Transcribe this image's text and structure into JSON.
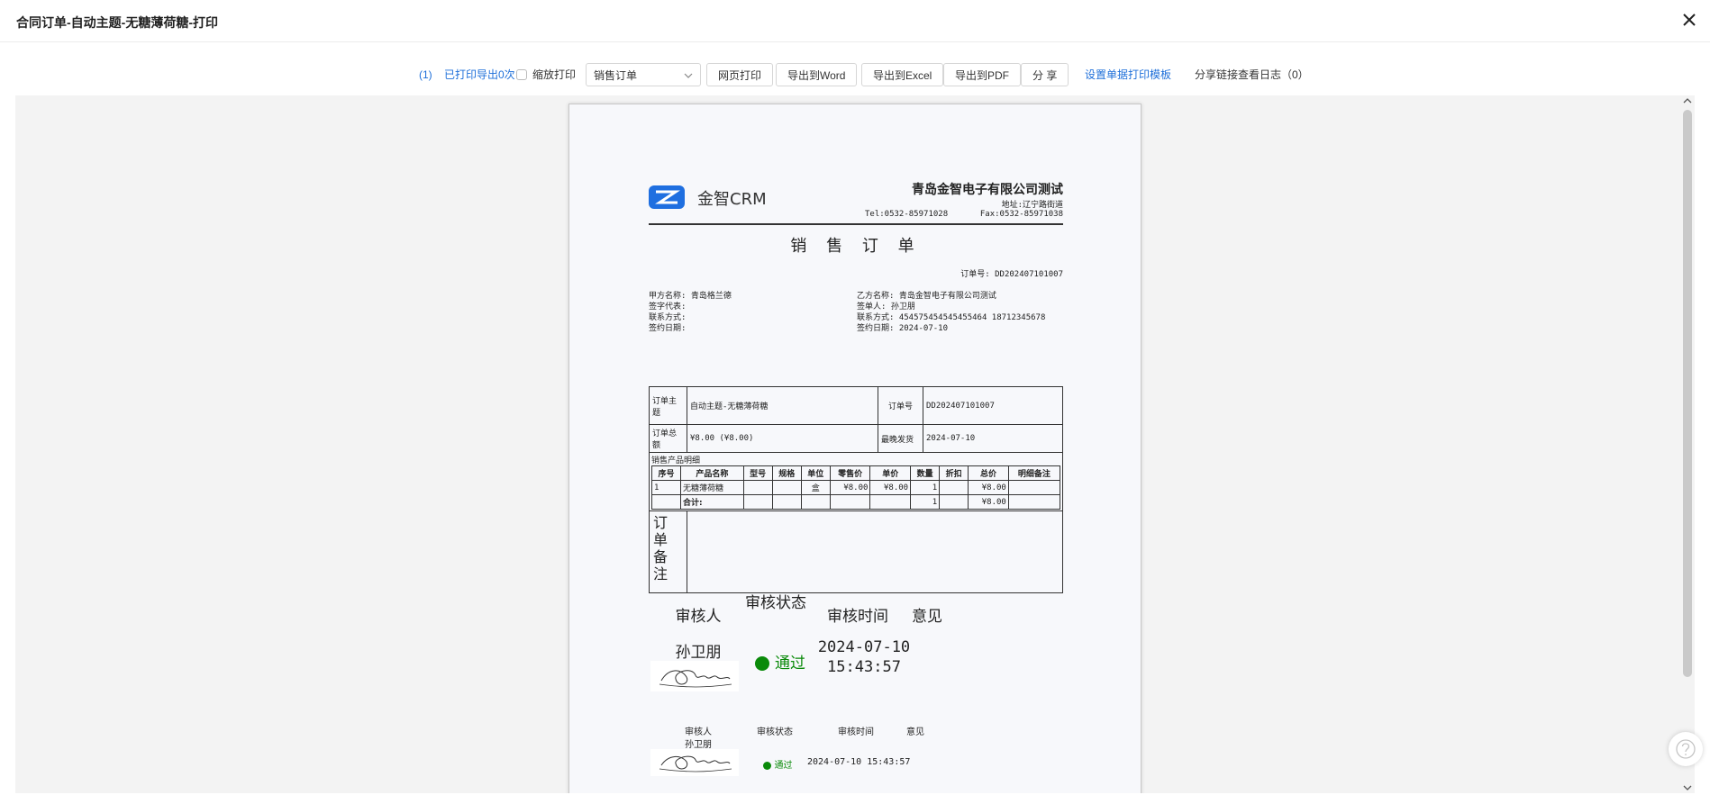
{
  "header": {
    "title": "合同订单-自动主题-无糖薄荷糖-打印"
  },
  "toolbar": {
    "print_count_link": "(1)",
    "printed_label": "已打印导出0次",
    "zoom_print_label": "缩放打印",
    "template_select": "销售订单",
    "web_print": "网页打印",
    "export_word": "导出到Word",
    "export_excel": "导出到Excel",
    "export_pdf": "导出到PDF",
    "share": "分 享",
    "set_template": "设置单据打印模板",
    "share_log": "分享链接查看日志（0）"
  },
  "document": {
    "logo_text": "金智CRM",
    "company": "青岛金智电子有限公司测试",
    "address": "地址:辽宁路街道",
    "tel": "Tel:0532-85971028",
    "fax": "Fax:0532-85971038",
    "title": "销 售 订 单",
    "order_no_line": "订单号: DD202407101007",
    "party_a": [
      "甲方名称: 青岛格兰德",
      "签字代表:",
      "联系方式:",
      "签约日期:"
    ],
    "party_b": [
      "乙方名称: 青岛金智电子有限公司测试",
      "签单人: 孙卫朋",
      "联系方式: 454575454545455464 18712345678",
      "签约日期: 2024-07-10"
    ],
    "info": {
      "subject_label": "订单主题",
      "subject_value": "自动主题-无糖薄荷糖",
      "order_no_label": "订单号",
      "order_no_value": "DD202407101007",
      "total_label": "订单总额",
      "total_value": "¥8.00 (¥8.00)",
      "ship_label": "最晚发货",
      "ship_value": "2024-07-10",
      "detail_label": "销售产品明细"
    },
    "products": {
      "headers": [
        "序号",
        "产品名称",
        "型号",
        "规格",
        "单位",
        "零售价",
        "单价",
        "数量",
        "折扣",
        "总价",
        "明细备注"
      ],
      "rows": [
        [
          "1",
          "无糖薄荷糖",
          "",
          "",
          "盒",
          "¥8.00",
          "¥8.00",
          "1",
          "",
          "¥8.00",
          ""
        ]
      ],
      "total_row": [
        "",
        "合计:",
        "",
        "",
        "",
        "",
        "",
        "1",
        "",
        "¥8.00",
        ""
      ]
    },
    "memo_label": "订\n单\n备\n注",
    "review_large": {
      "reviewer_h": "审核人",
      "status_h": "审核状态",
      "time_h": "审核时间",
      "opinion_h": "意见",
      "reviewer": "孙卫朋",
      "status": "通过",
      "time": "2024-07-10 15:43:57"
    },
    "review_small": {
      "reviewer_h": "审核人",
      "status_h": "审核状态",
      "time_h": "审核时间",
      "opinion_h": "意见",
      "reviewer": "孙卫朋",
      "status": "通过",
      "time": "2024-07-10 15:43:57"
    }
  },
  "colors": {
    "link": "#1e6fd9",
    "brand": "#1f6fe0",
    "approved": "#0a8a0a"
  }
}
